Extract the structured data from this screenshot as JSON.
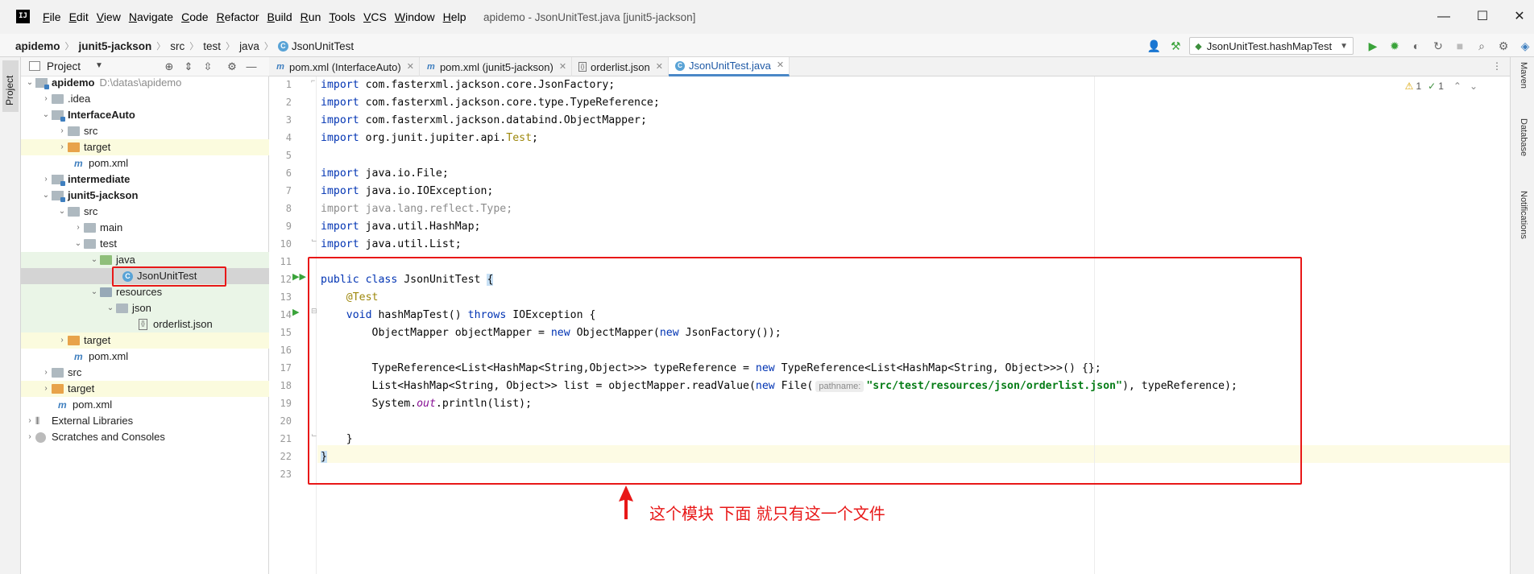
{
  "app": {
    "logo": "IJ",
    "window_title": "apidemo - JsonUnitTest.java [junit5-jackson]",
    "menu": [
      "File",
      "Edit",
      "View",
      "Navigate",
      "Code",
      "Refactor",
      "Build",
      "Run",
      "Tools",
      "VCS",
      "Window",
      "Help"
    ],
    "controls": {
      "minimize": "—",
      "maximize": "☐",
      "close": "✕"
    }
  },
  "breadcrumb": [
    "apidemo",
    "junit5-jackson",
    "src",
    "test",
    "java",
    "JsonUnitTest"
  ],
  "toolbar": {
    "run_config": "JsonUnitTest.hashMapTest",
    "icons": [
      "user-icon",
      "build-hammer-icon",
      "run-icon",
      "debug-icon",
      "coverage-icon",
      "profile-icon",
      "stop-icon",
      "search-icon",
      "gear-icon",
      "toolbox-icon"
    ]
  },
  "left_strip": {
    "project_tab": "Project"
  },
  "project_panel": {
    "title": "Project",
    "tree": [
      {
        "label": "apidemo",
        "path": "D:\\datas\\apidemo",
        "bold": true
      },
      {
        "label": ".idea"
      },
      {
        "label": "InterfaceAuto",
        "bold": true
      },
      {
        "label": "src"
      },
      {
        "label": "target"
      },
      {
        "label": "pom.xml"
      },
      {
        "label": "intermediate",
        "bold": true
      },
      {
        "label": "junit5-jackson",
        "bold": true
      },
      {
        "label": "src"
      },
      {
        "label": "main"
      },
      {
        "label": "test"
      },
      {
        "label": "java"
      },
      {
        "label": "JsonUnitTest"
      },
      {
        "label": "resources"
      },
      {
        "label": "json"
      },
      {
        "label": "orderlist.json"
      },
      {
        "label": "target"
      },
      {
        "label": "pom.xml"
      },
      {
        "label": "src"
      },
      {
        "label": "target"
      },
      {
        "label": "pom.xml"
      },
      {
        "label": "External Libraries"
      },
      {
        "label": "Scratches and Consoles"
      }
    ]
  },
  "tabs": [
    {
      "label": "pom.xml (InterfaceAuto)",
      "icon": "m"
    },
    {
      "label": "pom.xml (junit5-jackson)",
      "icon": "m"
    },
    {
      "label": "orderlist.json",
      "icon": "{}"
    },
    {
      "label": "JsonUnitTest.java",
      "icon": "C",
      "active": true
    }
  ],
  "editor": {
    "inspection": {
      "warnings": "1",
      "weak_warnings": "1"
    },
    "param_hint": "pathname:",
    "line_numbers": [
      "1",
      "2",
      "3",
      "4",
      "5",
      "6",
      "7",
      "8",
      "9",
      "10",
      "11",
      "12",
      "13",
      "14",
      "15",
      "16",
      "17",
      "18",
      "19",
      "20",
      "21",
      "22",
      "23"
    ]
  },
  "annotation": {
    "text": "这个模块 下面 就只有这一个文件"
  },
  "right_strip": [
    "Maven",
    "Database",
    "Notifications"
  ],
  "colors": {
    "annotation_red": "#e81818",
    "keyword": "#0033b3",
    "string": "#067d17",
    "annotation": "#9e880d"
  }
}
